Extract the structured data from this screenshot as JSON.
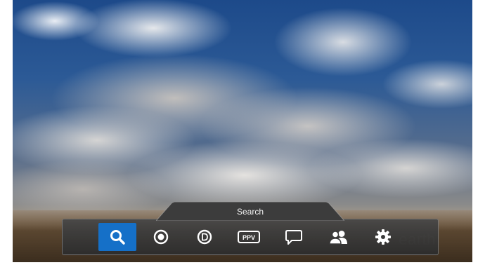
{
  "menu": {
    "title": "Search",
    "selected_index": 0,
    "items": [
      {
        "icon": "search-icon"
      },
      {
        "icon": "record-icon"
      },
      {
        "icon": "d-circle-icon"
      },
      {
        "icon": "ppv-icon",
        "label": "PPV"
      },
      {
        "icon": "message-icon"
      },
      {
        "icon": "users-icon"
      },
      {
        "icon": "gear-icon"
      }
    ]
  },
  "background": {
    "watermark": "earth"
  },
  "colors": {
    "selected": "#1570c8",
    "menu_bg": "#3a3a3a",
    "icon": "#ffffff"
  }
}
